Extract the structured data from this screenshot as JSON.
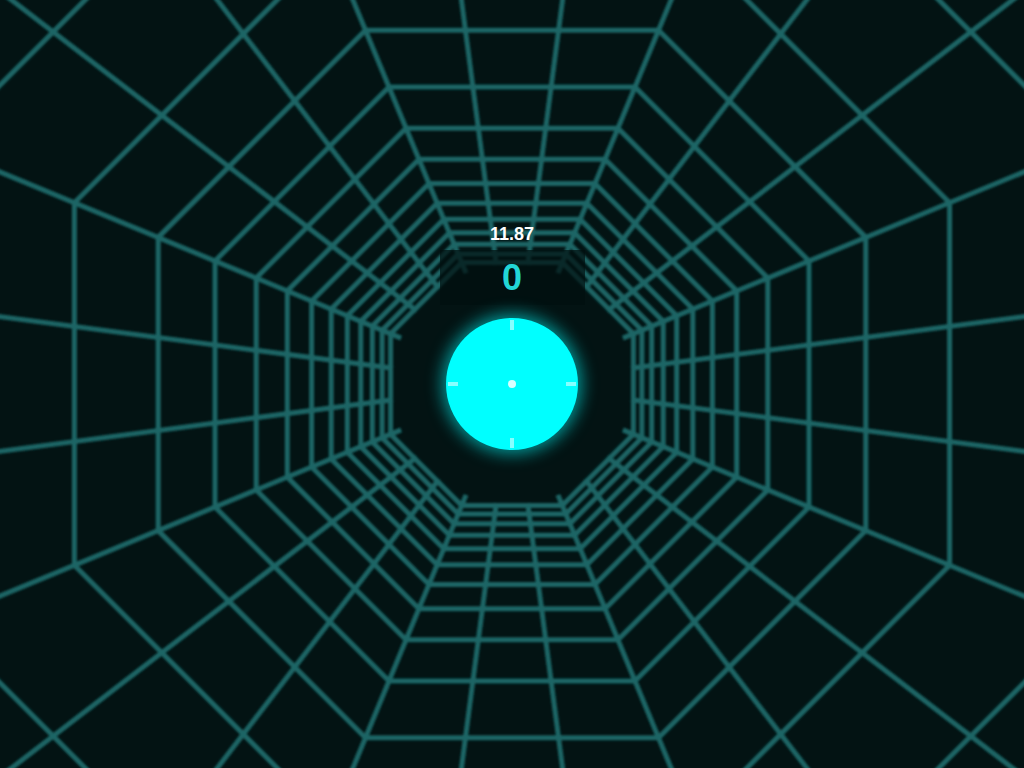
{
  "hud": {
    "timer": "11.87",
    "score": "0"
  }
}
